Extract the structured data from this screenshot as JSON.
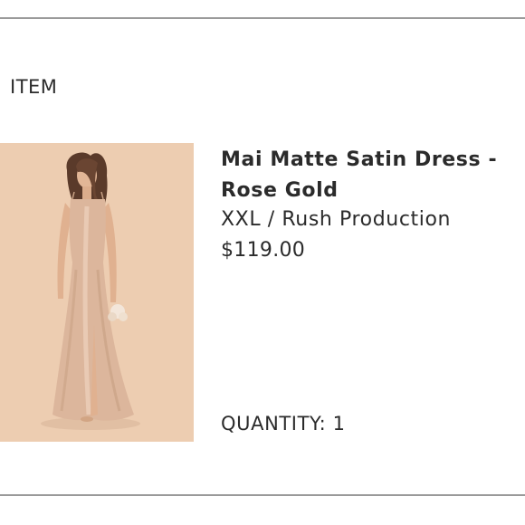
{
  "section": {
    "label": "ITEM"
  },
  "item": {
    "name": "Mai Matte Satin Dress - Rose Gold",
    "variant": "XXL / Rush Production",
    "price": "$119.00",
    "quantity_label": "QUANTITY: 1",
    "image_background": "#edcdb1",
    "dress_color": "#dcb69c"
  }
}
